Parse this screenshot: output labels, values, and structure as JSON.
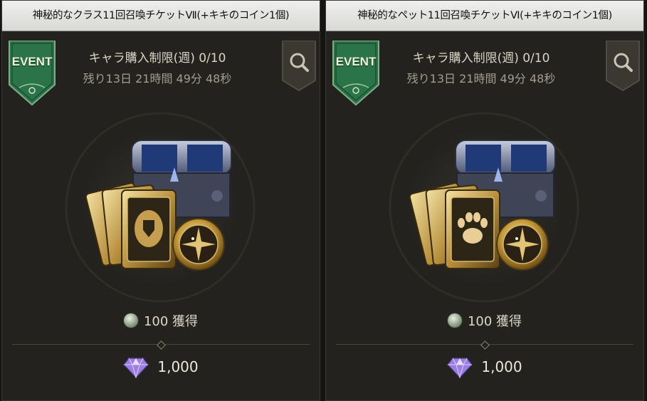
{
  "cards": [
    {
      "title": "神秘的なクラス11回召喚チケットⅦ(+キキのコイン1個)",
      "badge": "EVENT",
      "limit": "キャラ購入制限(週) 0/10",
      "remaining": "残り13日 21時間 49分 48秒",
      "reward_amount": "100",
      "reward_label": "獲得",
      "price": "1,000"
    },
    {
      "title": "神秘的なペット11回召喚チケットⅥ(+キキのコイン1個)",
      "badge": "EVENT",
      "limit": "キャラ購入制限(週) 0/10",
      "remaining": "残り13日 21時間 49分 48秒",
      "reward_amount": "100",
      "reward_label": "獲得",
      "price": "1,000"
    }
  ],
  "icons": {
    "badge": "event-badge-icon",
    "search": "search-icon",
    "reward": "mileage-coin-icon",
    "currency": "diamond-gem-icon",
    "art_left": "class-summon-bundle-illustration",
    "art_right": "pet-summon-bundle-illustration"
  },
  "colors": {
    "panel": "#23221f",
    "title_bar": "#e5e5e3",
    "badge_green": "#2d7a4d",
    "text_gold": "#d9d4c4",
    "text_dim": "#a39e90",
    "gem_purple": "#9b7fe0"
  }
}
